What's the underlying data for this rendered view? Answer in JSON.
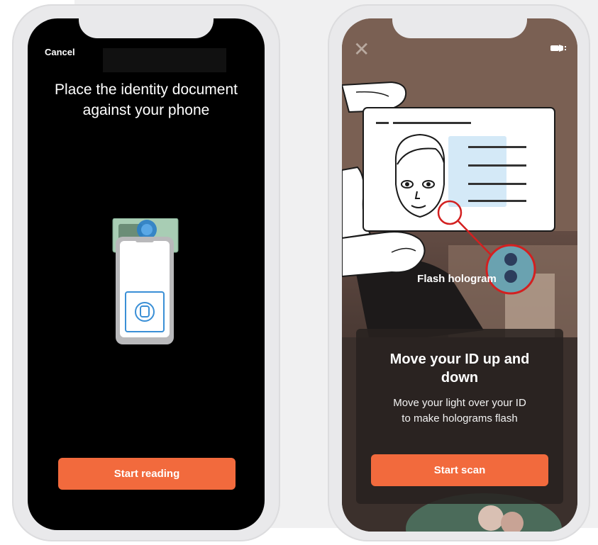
{
  "left_phone": {
    "cancel_label": "Cancel",
    "headline": "Place the identity document against your phone",
    "start_button": "Start reading"
  },
  "right_phone": {
    "close_icon": "close-icon",
    "flashlight_icon": "flashlight-icon",
    "hint_label": "Flash hologram",
    "title": "Move your ID up and down",
    "subtitle": "Move your light over your ID to make holograms flash",
    "start_button": "Start scan"
  },
  "colors": {
    "accent": "#f26a3d",
    "screen_black": "#000000",
    "hologram_ring": "#d32020"
  }
}
